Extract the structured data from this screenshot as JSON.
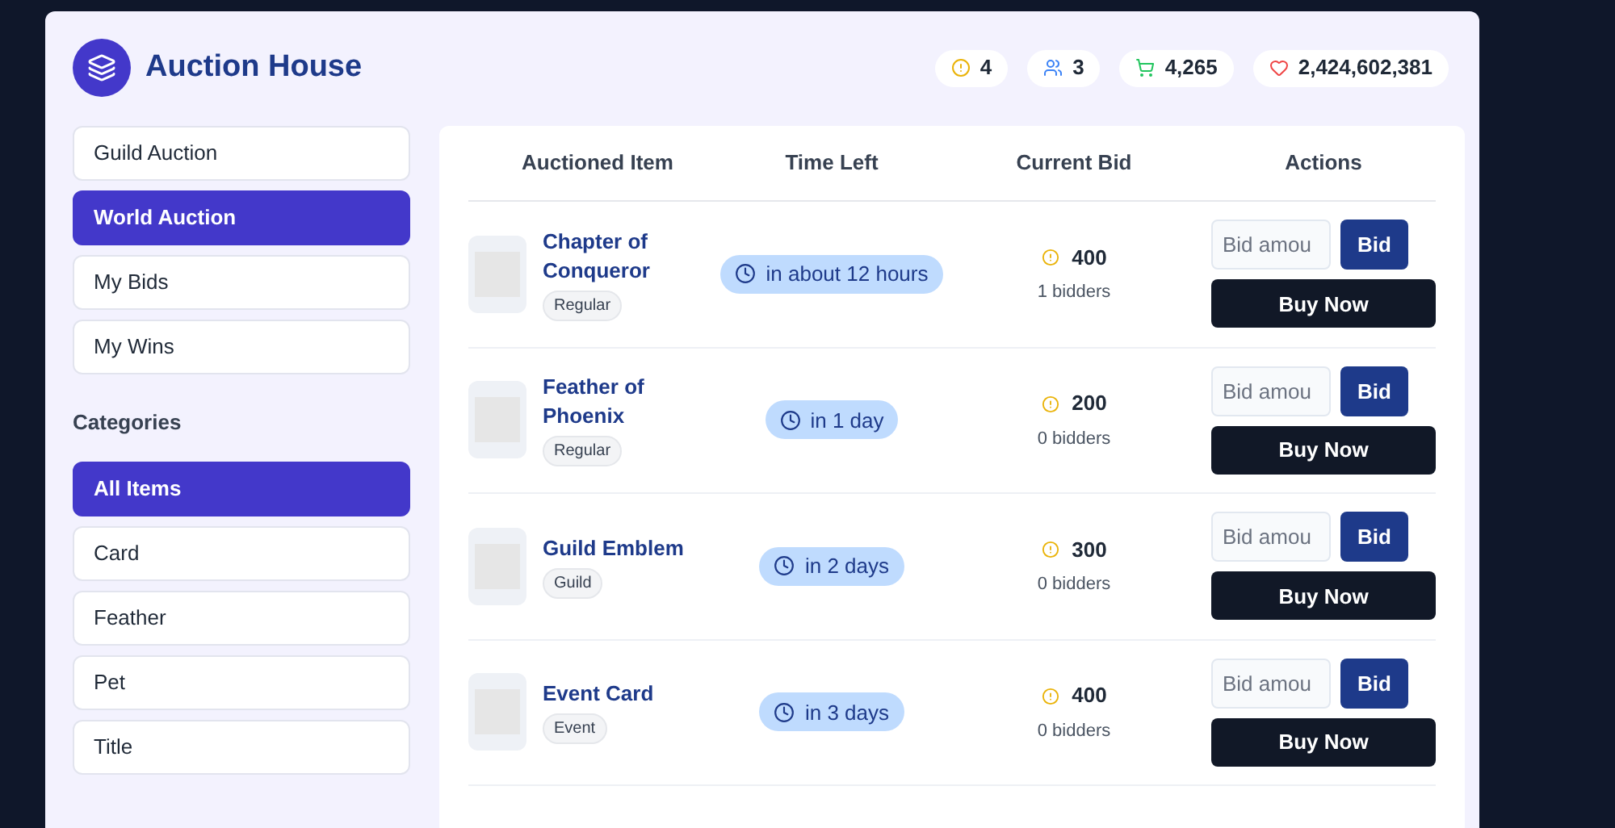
{
  "header": {
    "title": "Auction House",
    "stats": [
      {
        "kind": "alert",
        "value": "4"
      },
      {
        "kind": "users",
        "value": "3"
      },
      {
        "kind": "cart",
        "value": "4,265"
      },
      {
        "kind": "heart",
        "value": "2,424,602,381"
      }
    ]
  },
  "nav": [
    {
      "label": "Guild Auction",
      "selected": false
    },
    {
      "label": "World Auction",
      "selected": true
    },
    {
      "label": "My Bids",
      "selected": false
    },
    {
      "label": "My Wins",
      "selected": false
    }
  ],
  "categories": {
    "title": "Categories",
    "items": [
      {
        "label": "All Items",
        "selected": true
      },
      {
        "label": "Card",
        "selected": false
      },
      {
        "label": "Feather",
        "selected": false
      },
      {
        "label": "Pet",
        "selected": false
      },
      {
        "label": "Title",
        "selected": false
      }
    ]
  },
  "table": {
    "columns": [
      "Auctioned Item",
      "Time Left",
      "Current Bid",
      "Actions"
    ],
    "rows": [
      {
        "name": "Chapter of Conqueror",
        "tag": "Regular",
        "time_left": "in about 12 hours",
        "bid": "400",
        "bidders": "1 bidders",
        "bid_placeholder": "Bid amou",
        "bid_button": "Bid",
        "buy_button": "Buy Now"
      },
      {
        "name": "Feather of Phoenix",
        "tag": "Regular",
        "time_left": "in 1 day",
        "bid": "200",
        "bidders": "0 bidders",
        "bid_placeholder": "Bid amou",
        "bid_button": "Bid",
        "buy_button": "Buy Now"
      },
      {
        "name": "Guild Emblem",
        "tag": "Guild",
        "time_left": "in 2 days",
        "bid": "300",
        "bidders": "0 bidders",
        "bid_placeholder": "Bid amou",
        "bid_button": "Bid",
        "buy_button": "Buy Now"
      },
      {
        "name": "Event Card",
        "tag": "Event",
        "time_left": "in 3 days",
        "bid": "400",
        "bidders": "0 bidders",
        "bid_placeholder": "Bid amou",
        "bid_button": "Bid",
        "buy_button": "Buy Now"
      }
    ]
  }
}
